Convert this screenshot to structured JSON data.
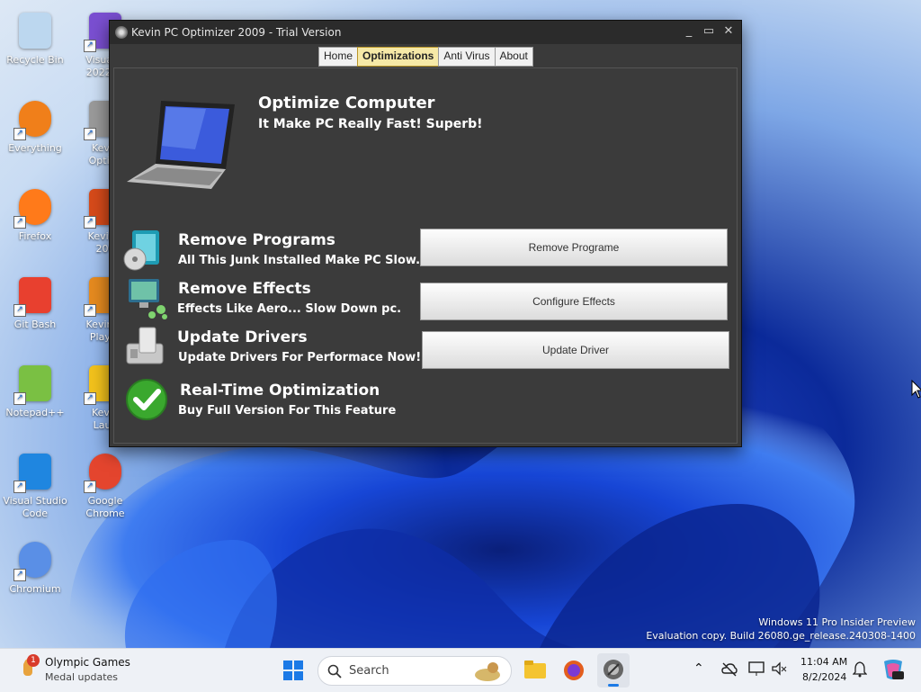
{
  "desktop": {
    "icons": [
      {
        "label": "Recycle Bin",
        "icon": "recycle-bin-icon"
      },
      {
        "label": "Visual S\n2022 Pr",
        "icon": "visual-studio-icon"
      },
      {
        "label": "Everything",
        "icon": "everything-search-icon"
      },
      {
        "label": "Kevin\nOptimi",
        "icon": "kevin-optimizer-icon"
      },
      {
        "label": "Firefox",
        "icon": "firefox-icon"
      },
      {
        "label": "KevinO\n200",
        "icon": "kevin-office-icon"
      },
      {
        "label": "Git Bash",
        "icon": "git-bash-icon"
      },
      {
        "label": "Kevin M\nPlayer",
        "icon": "media-player-icon"
      },
      {
        "label": "Notepad++",
        "icon": "notepadpp-icon"
      },
      {
        "label": "Kevin\nLaun",
        "icon": "launcher-icon"
      },
      {
        "label": "Visual Studio\nCode",
        "icon": "vscode-icon"
      },
      {
        "label": "Google\nChrome",
        "icon": "chrome-icon"
      },
      {
        "label": "Chromium",
        "icon": "chromium-icon"
      }
    ]
  },
  "window": {
    "title": "Kevin PC Optimizer 2009 - Trial Version",
    "controls": {
      "minimize": "_",
      "maximize": "▭",
      "close": "✕"
    },
    "tabs": [
      {
        "label": "Home",
        "active": false
      },
      {
        "label": "Optimizations",
        "active": true
      },
      {
        "label": "Anti Virus",
        "active": false
      },
      {
        "label": "About",
        "active": false
      }
    ],
    "header": {
      "title": "Optimize Computer",
      "subtitle": "It Make PC Really Fast! Superb!"
    },
    "rows": [
      {
        "title": "Remove Programs",
        "subtitle": "All This Junk Installed Make PC Slow.",
        "button": "Remove Programe",
        "icon": "remove-programs-icon"
      },
      {
        "title": "Remove Effects",
        "subtitle": "Effects Like Aero... Slow Down pc.",
        "button": "Configure Effects",
        "icon": "display-effects-icon"
      },
      {
        "title": "Update Drivers",
        "subtitle": "Update Drivers For Performace Now!",
        "button": "Update Driver",
        "icon": "drivers-icon"
      },
      {
        "title": "Real-Time Optimization",
        "subtitle": "Buy Full Version For This Feature",
        "icon": "checkmark-icon"
      }
    ]
  },
  "watermark": {
    "line1": "Windows 11 Pro Insider Preview",
    "line2": "Evaluation copy. Build 26080.ge_release.240308-1400"
  },
  "taskbar": {
    "widget_title": "Olympic Games",
    "widget_sub": "Medal updates",
    "widget_badge": "1",
    "search_placeholder": "Search",
    "time": "11:04 AM",
    "date": "8/2/2024"
  }
}
